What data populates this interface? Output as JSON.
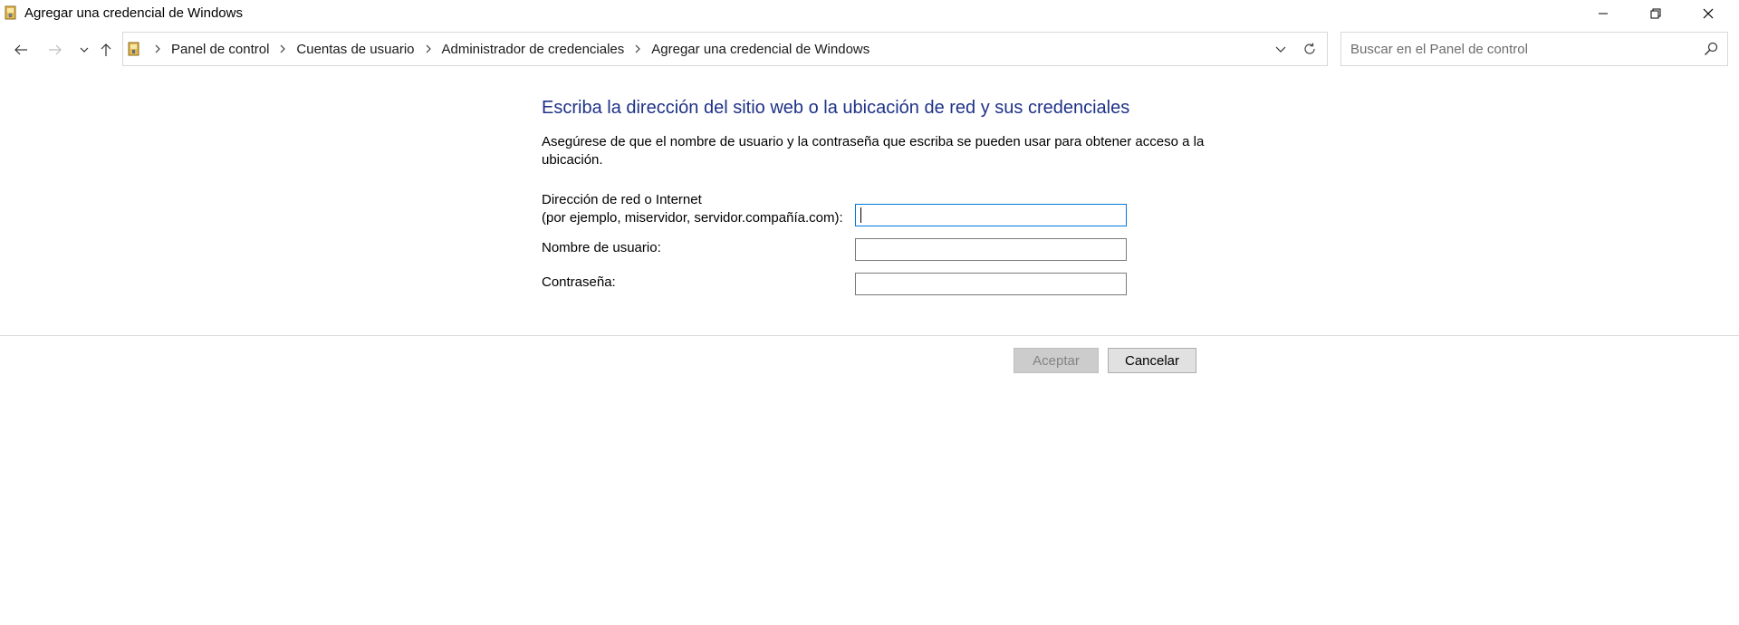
{
  "window": {
    "title": "Agregar una credencial de Windows",
    "icon": "credential-manager-icon"
  },
  "nav": {
    "breadcrumbs": [
      {
        "label": "Panel de control"
      },
      {
        "label": "Cuentas de usuario"
      },
      {
        "label": "Administrador de credenciales"
      },
      {
        "label": "Agregar una credencial de Windows"
      }
    ],
    "search_placeholder": "Buscar en el Panel de control",
    "search_value": ""
  },
  "form": {
    "heading": "Escriba la dirección del sitio web o la ubicación de red y sus credenciales",
    "description": "Asegúrese de que el nombre de usuario y la contraseña que escriba se pueden usar para obtener acceso a la ubicación.",
    "address_label_line1": "Dirección de red o Internet",
    "address_label_line2": "(por ejemplo, miservidor, servidor.compañía.com):",
    "address_value": "",
    "username_label": "Nombre de usuario:",
    "username_value": "",
    "password_label": "Contraseña:",
    "password_value": ""
  },
  "buttons": {
    "ok_label": "Aceptar",
    "cancel_label": "Cancelar"
  },
  "colors": {
    "heading": "#1e3287",
    "focus_border": "#0078d7"
  }
}
